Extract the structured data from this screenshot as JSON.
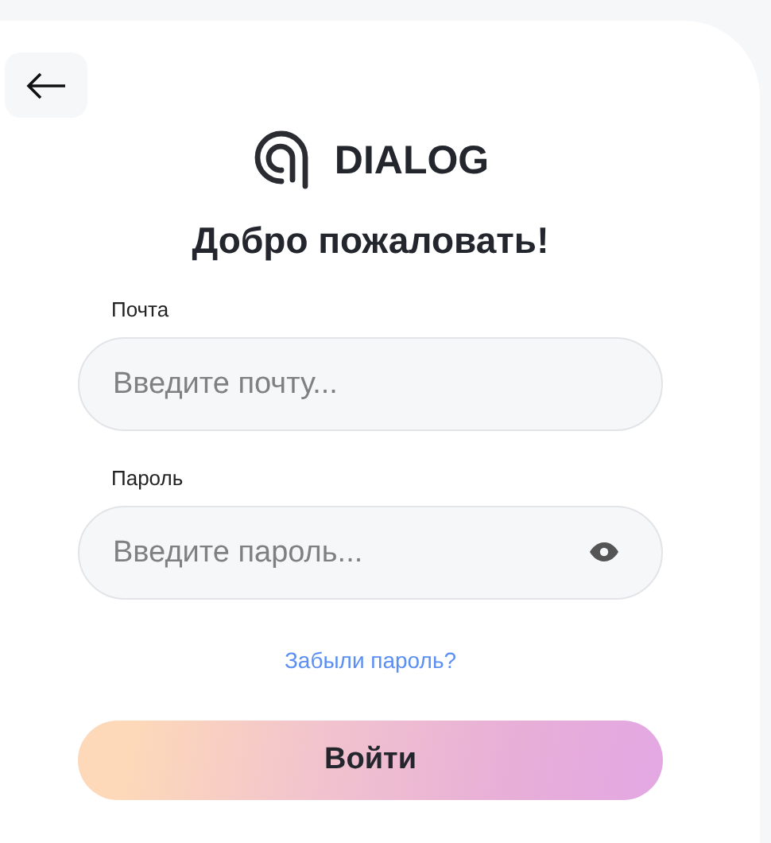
{
  "brand": {
    "name": "DIALOG"
  },
  "title": "Добро пожаловать!",
  "fields": [
    {
      "kind": "email",
      "label": "Почта",
      "placeholder": "Введите почту..."
    },
    {
      "kind": "password",
      "label": "Пароль",
      "placeholder": "Введите пароль..."
    }
  ],
  "forgot_link": "Забыли пароль?",
  "submit_button": "Войти"
}
